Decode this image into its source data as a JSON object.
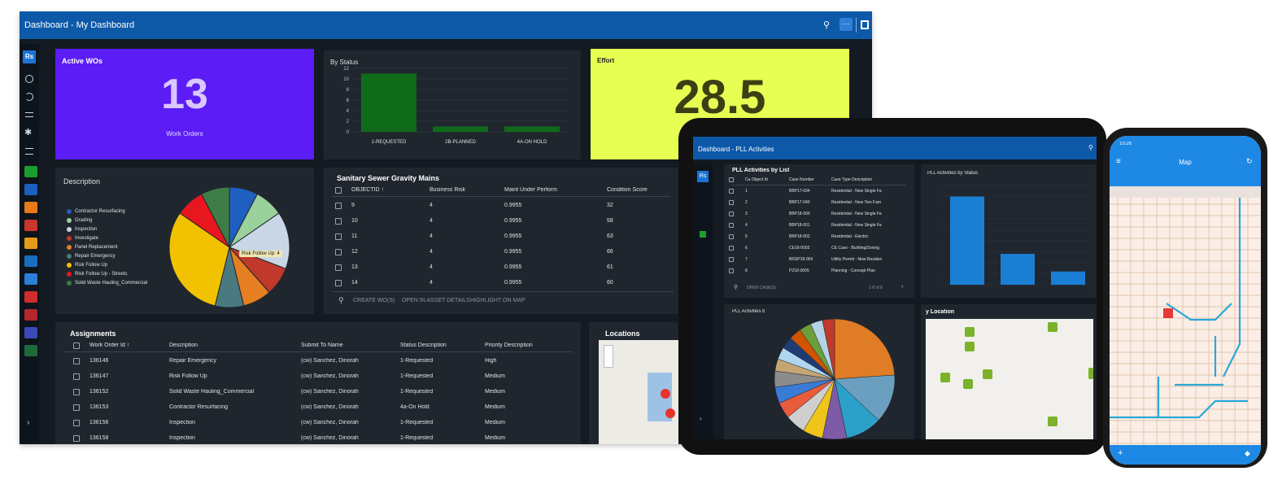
{
  "desktop": {
    "title": "Dashboard - My Dashboard",
    "sidebar": {
      "app_badge": "Rs",
      "collapse": "›"
    },
    "active_wos": {
      "title": "Active WOs",
      "value": "13",
      "label": "Work Orders",
      "color": "#5b1cf5"
    },
    "effort": {
      "title": "Effort",
      "value": "28.5",
      "color": "#e6ff52"
    },
    "description_title": "Description",
    "pie_legend": [
      "Contractor Resurfacing",
      "Grading",
      "Inspection",
      "Investigate",
      "Panel Replacement",
      "Repair Emergency",
      "Risk Follow Up",
      "Risk Follow Up - Streets",
      "Solid Waste Hauling_Commercial"
    ],
    "pie_tooltip": "Risk Follow Up: 4",
    "sewer": {
      "title": "Sanitary Sewer Gravity Mains",
      "columns": [
        "OBJECTID ↑",
        "Business Risk",
        "Maint Under Perform",
        "Condition Score"
      ],
      "rows": [
        [
          "9",
          "4",
          "0.9955",
          "32"
        ],
        [
          "10",
          "4",
          "0.9955",
          "58"
        ],
        [
          "11",
          "4",
          "0.9955",
          "63"
        ],
        [
          "12",
          "4",
          "0.9955",
          "66"
        ],
        [
          "13",
          "4",
          "0.9955",
          "61"
        ],
        [
          "14",
          "4",
          "0.9955",
          "60"
        ]
      ],
      "actions": [
        "CREATE WO(S)",
        "OPEN IN ASSET DETAILS",
        "HIGHLIGHT ON MAP"
      ]
    },
    "assignments": {
      "title": "Assignments",
      "columns": [
        "Work Order Id ↑",
        "Description",
        "Submit To Name",
        "Status Description",
        "Priority Description"
      ],
      "rows": [
        [
          "136146",
          "Repair Emergency",
          "(cw) Sanchez, Dinorah",
          "1-Requested",
          "High"
        ],
        [
          "136147",
          "Risk Follow Up",
          "(cw) Sanchez, Dinorah",
          "1-Requested",
          "Medium"
        ],
        [
          "136152",
          "Solid Waste Hauling_Commercial",
          "(cw) Sanchez, Dinorah",
          "1-Requested",
          "Medium"
        ],
        [
          "136153",
          "Contractor Resurfacing",
          "(cw) Sanchez, Dinorah",
          "4a-On Hold",
          "Medium"
        ],
        [
          "136156",
          "Inspection",
          "(cw) Sanchez, Dinorah",
          "1-Requested",
          "Medium"
        ],
        [
          "136158",
          "Inspection",
          "(cw) Sanchez, Dinorah",
          "1-Requested",
          "Medium"
        ]
      ]
    },
    "locations_title": "Locations"
  },
  "chart_data": [
    {
      "type": "bar",
      "title": "By Status",
      "categories": [
        "1-REQUESTED",
        "2B-PLANNED",
        "4A-ON HOLD"
      ],
      "values": [
        11,
        1,
        1
      ],
      "ylim": [
        0,
        12
      ],
      "yticks": [
        0,
        2,
        4,
        6,
        8,
        10,
        12
      ],
      "color": "#0f6b1a"
    },
    {
      "type": "pie",
      "title": "Description",
      "labels": [
        "Contractor Resurfacing",
        "Grading",
        "Inspection",
        "Investigate",
        "Panel Replacement",
        "Repair Emergency",
        "Risk Follow Up",
        "Risk Follow Up - Streets",
        "Solid Waste Hauling_Commercial"
      ],
      "values": [
        1,
        1,
        2,
        1,
        1,
        1,
        4,
        1,
        1
      ],
      "colors": [
        "#1f5fbf",
        "#9bd19b",
        "#c9d6e6",
        "#c0392b",
        "#e67e22",
        "#4a7a80",
        "#f2c200",
        "#e8161f",
        "#3e7d47"
      ]
    },
    {
      "type": "bar",
      "title": "PLL Activities by Status",
      "values": [
        40,
        14,
        6
      ],
      "ylim": [
        0,
        45
      ],
      "color": "#1a7fd4"
    }
  ],
  "tablet": {
    "title": "Dashboard - PLL Activities",
    "list_title": "PLL Activities by List",
    "columns": [
      "Ca Object Id",
      "Case Number",
      "Case Type Description"
    ],
    "rows": [
      [
        "1",
        "BBP17-034",
        "Residential - New Single Fa"
      ],
      [
        "2",
        "BBP17-040",
        "Residential - New Two Fam"
      ],
      [
        "3",
        "BBP18-000",
        "Residential - New Single Fa"
      ],
      [
        "4",
        "BBP18-001",
        "Residential - New Single Fa"
      ],
      [
        "5",
        "BBP18-002",
        "Residential - Electric"
      ],
      [
        "6",
        "CE18-0003",
        "CE Case - Building/Zoning"
      ],
      [
        "7",
        "BRSP18-004",
        "Utility Permit - New Residen"
      ],
      [
        "8",
        "PZ18-0005",
        "Planning - Concept Plan"
      ]
    ],
    "footer_btn": "OPEN CASE(S)",
    "paging": "1-8 of 8",
    "status_title": "PLL Activities by Status",
    "pie_title": "PLL Activities b",
    "loc_title": "y Location"
  },
  "phone": {
    "time": "10:26",
    "title": "Map"
  }
}
